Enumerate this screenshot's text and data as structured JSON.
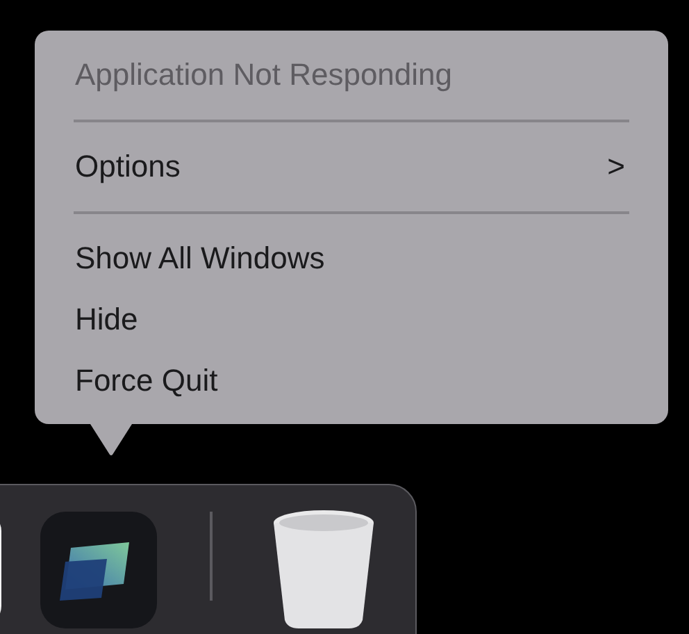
{
  "menu": {
    "items": [
      {
        "kind": "header",
        "label": "Application Not Responding",
        "disabled": true
      },
      {
        "kind": "separator"
      },
      {
        "kind": "submenu",
        "label": "Options",
        "arrow": ">",
        "disabled": false
      },
      {
        "kind": "separator"
      },
      {
        "kind": "item",
        "label": "Show All Windows",
        "disabled": false
      },
      {
        "kind": "item",
        "label": "Hide",
        "disabled": false
      },
      {
        "kind": "item",
        "label": "Force Quit",
        "disabled": false
      }
    ]
  }
}
